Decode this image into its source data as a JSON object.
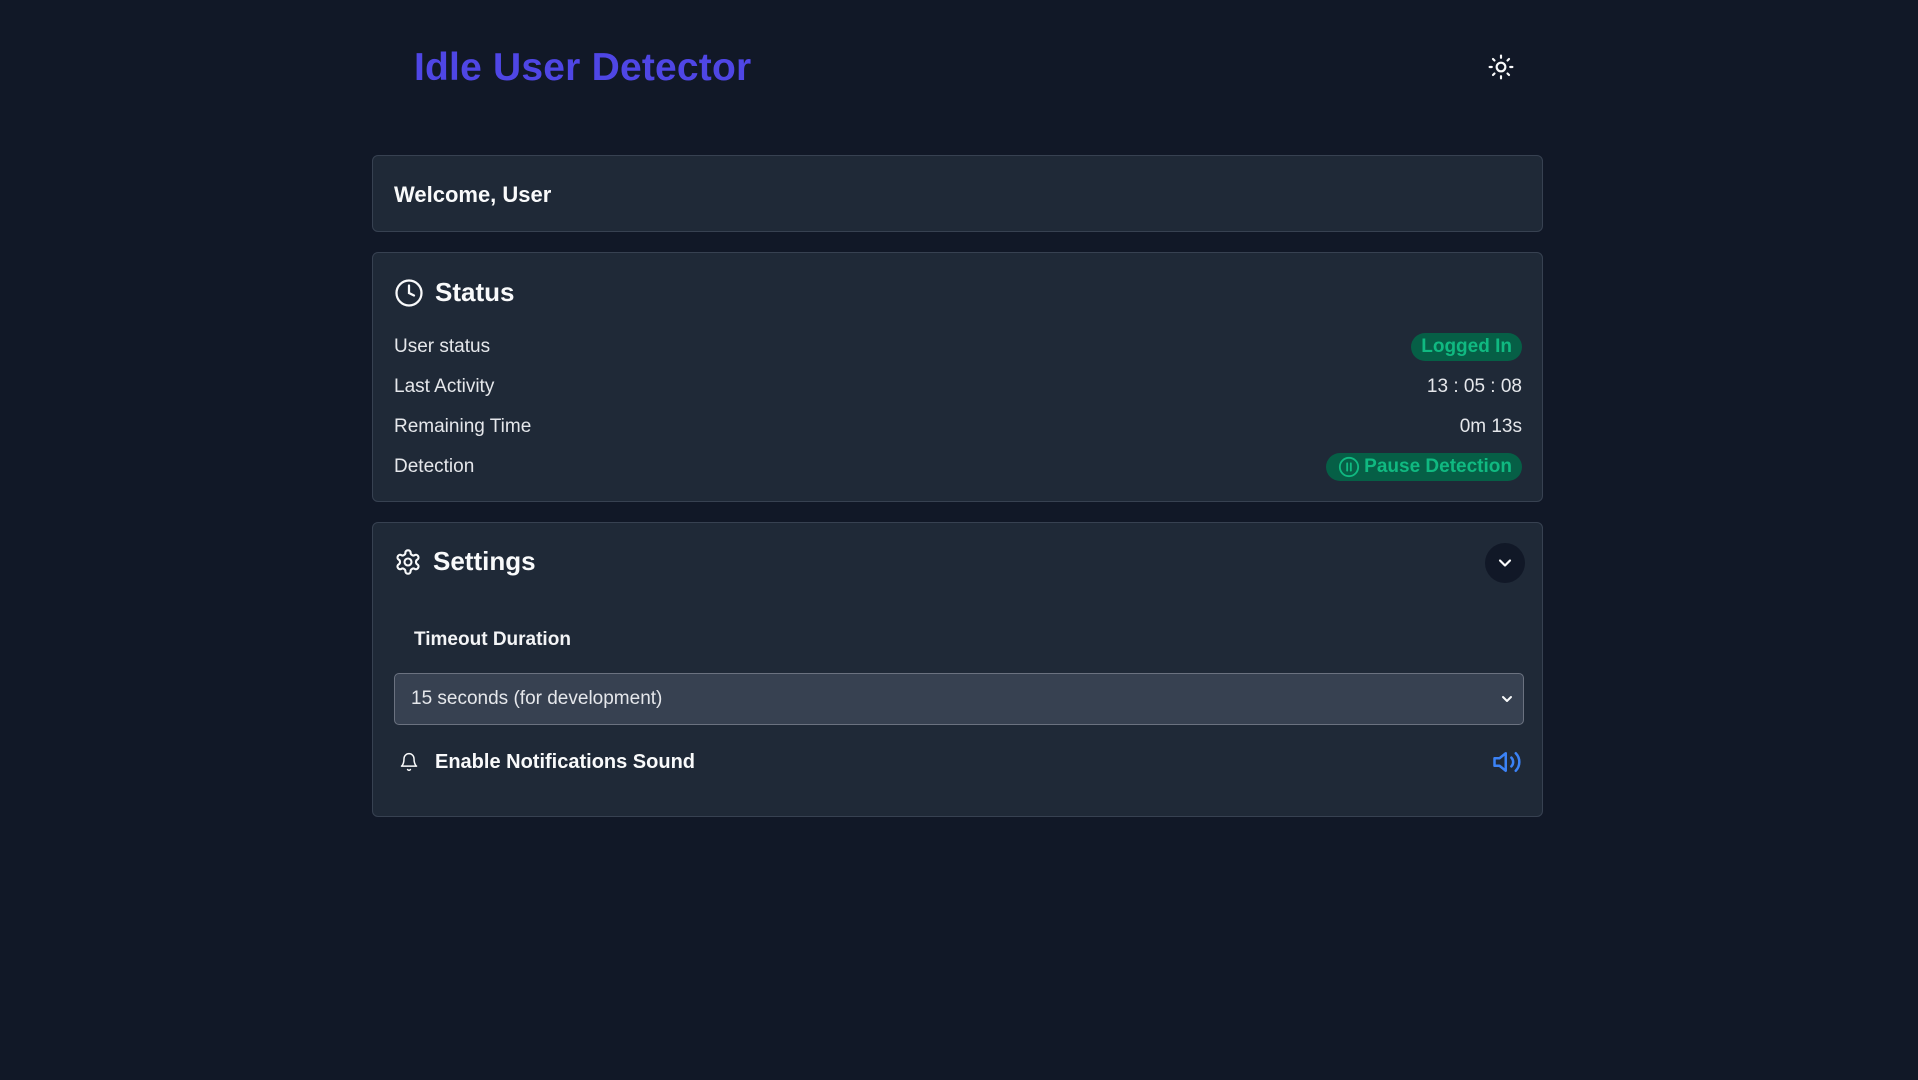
{
  "app": {
    "title": "Idle User Detector",
    "theme_icon": "sun-icon"
  },
  "welcome": {
    "text": "Welcome, User"
  },
  "status": {
    "title": "Status",
    "icon": "clock-icon",
    "rows": [
      {
        "label": "User status",
        "value": "Logged In"
      },
      {
        "label": "Last Activity",
        "value": "13 : 05 : 08"
      },
      {
        "label": "Remaining Time",
        "value": "0m 13s"
      },
      {
        "label": "Detection",
        "value": "Pause Detection"
      }
    ],
    "pause_icon": "pause-circle-icon"
  },
  "settings": {
    "title": "Settings",
    "icon": "gear-icon",
    "collapse_icon": "chevron-down-icon",
    "timeout_label": "Timeout Duration",
    "timeout_selected": "15 seconds (for development)",
    "notifications_label": "Enable Notifications Sound",
    "notifications_icon": "bell-icon",
    "sound_icon": "speaker-on-icon"
  },
  "colors": {
    "background": "#111827",
    "card": "#1f2937",
    "accent": "#4f46e5",
    "success_bg": "#065f46",
    "success_text": "#10b981",
    "sound_icon": "#3b82f6"
  }
}
